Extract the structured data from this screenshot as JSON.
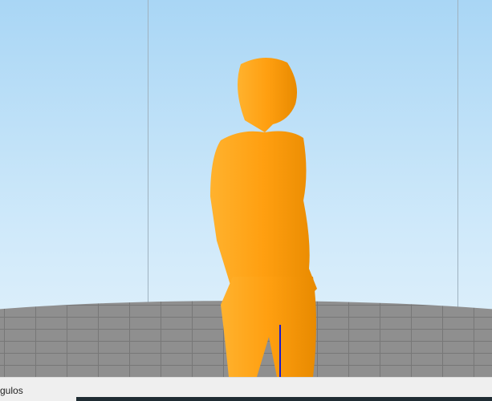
{
  "viewport": {
    "model_color": "#ffa31a",
    "sky_color": "#a9d6f5",
    "plate_color": "#8f8f8f"
  },
  "bottom_bar": {
    "label": "gulos"
  }
}
